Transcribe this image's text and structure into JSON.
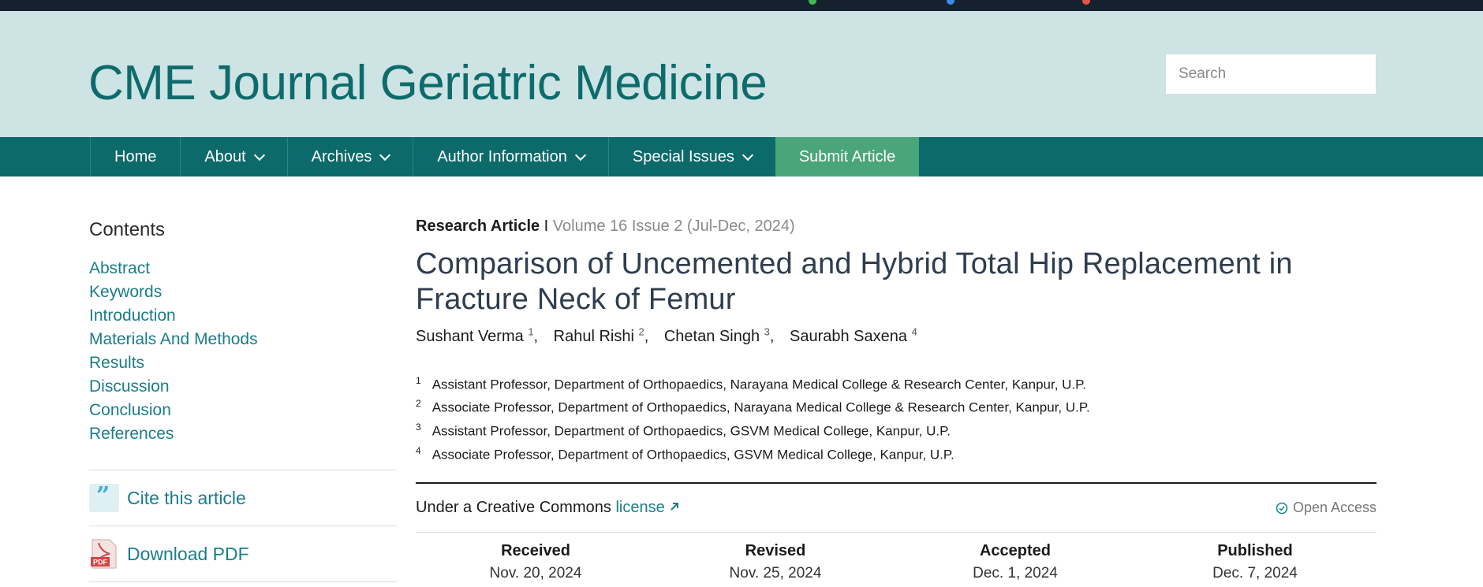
{
  "header": {
    "site_title": "CME Journal Geriatric Medicine",
    "search_placeholder": "Search"
  },
  "nav": {
    "items": [
      {
        "label": "Home"
      },
      {
        "label": "About"
      },
      {
        "label": "Archives"
      },
      {
        "label": "Author Information"
      },
      {
        "label": "Special Issues"
      },
      {
        "label": "Submit Article"
      }
    ]
  },
  "sidebar": {
    "contents_title": "Contents",
    "toc": [
      "Abstract",
      "Keywords",
      "Introduction",
      "Materials And Methods",
      "Results",
      "Discussion",
      "Conclusion",
      "References"
    ],
    "cite_label": "Cite this article",
    "download_label": "Download PDF",
    "pdf_badge": "PDF"
  },
  "article": {
    "type": "Research Article",
    "separator": " I ",
    "volume": "Volume 16 Issue 2 (Jul-Dec, 2024)",
    "title": "Comparison of Uncemented and Hybrid Total Hip Replacement in Fracture Neck of Femur",
    "authors": [
      {
        "name": "Sushant Verma",
        "sup": "1",
        "sep": ","
      },
      {
        "name": "Rahul Rishi",
        "sup": "2",
        "sep": ","
      },
      {
        "name": "Chetan Singh",
        "sup": "3",
        "sep": ","
      },
      {
        "name": "Saurabh Saxena",
        "sup": "4",
        "sep": ""
      }
    ],
    "affiliations": [
      {
        "num": "1",
        "text": "Assistant Professor, Department of Orthopaedics, Narayana Medical College & Research Center, Kanpur, U.P."
      },
      {
        "num": "2",
        "text": "Associate Professor, Department of Orthopaedics, Narayana Medical College & Research Center, Kanpur, U.P."
      },
      {
        "num": "3",
        "text": "Assistant Professor, Department of Orthopaedics, GSVM Medical College, Kanpur, U.P."
      },
      {
        "num": "4",
        "text": "Associate Professor, Department of Orthopaedics, GSVM Medical College, Kanpur, U.P."
      }
    ],
    "license_prefix": "Under a Creative Commons ",
    "license_link": "license",
    "open_access": "Open Access",
    "dates": [
      {
        "label": "Received",
        "value": "Nov. 20, 2024"
      },
      {
        "label": "Revised",
        "value": "Nov. 25, 2024"
      },
      {
        "label": "Accepted",
        "value": "Dec. 1, 2024"
      },
      {
        "label": "Published",
        "value": "Dec. 7, 2024"
      }
    ]
  },
  "colors": {
    "brand_teal": "#0c6a6a",
    "header_bg": "#cde3e4",
    "submit_green": "#4aa678",
    "link": "#1a7d8a"
  }
}
